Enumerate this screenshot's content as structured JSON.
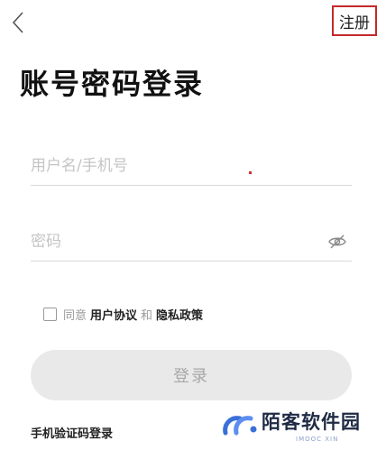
{
  "header": {
    "register_label": "注册"
  },
  "page_title": "账号密码登录",
  "form": {
    "username_placeholder": "用户名/手机号",
    "password_placeholder": "密码"
  },
  "agreement": {
    "prefix": "同意",
    "user_agreement": "用户协议",
    "and": "和",
    "privacy_policy": "隐私政策"
  },
  "login_button_label": "登录",
  "sms_login_label": "手机验证码登录",
  "watermark": {
    "title": "陌客软件园",
    "subtitle": "IMOOC XIN"
  },
  "colors": {
    "register_border": "#c62828",
    "login_button_bg": "#e9e9e9",
    "placeholder": "#c4c4c4"
  },
  "icons": [
    "chevron-left-icon",
    "eye-off-icon",
    "watermark-logo-icon"
  ]
}
